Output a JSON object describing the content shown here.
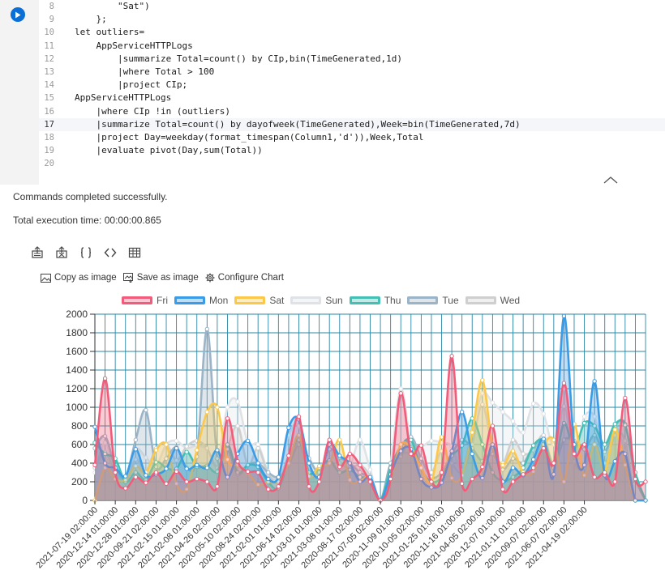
{
  "editor": {
    "lines": [
      {
        "num": "8",
        "text": "        \"Sat\")"
      },
      {
        "num": "9",
        "text": "    };"
      },
      {
        "num": "10",
        "text": "let outliers="
      },
      {
        "num": "11",
        "text": "    AppServiceHTTPLogs"
      },
      {
        "num": "12",
        "text": "        |summarize Total=count() by CIp,bin(TimeGenerated,1d)"
      },
      {
        "num": "13",
        "text": "        |where Total > 100"
      },
      {
        "num": "14",
        "text": "        |project CIp;"
      },
      {
        "num": "15",
        "text": "AppServiceHTTPLogs"
      },
      {
        "num": "16",
        "text": "    |where CIp !in (outliers)"
      },
      {
        "num": "17",
        "text": "    |summarize Total=count() by dayofweek(TimeGenerated),Week=bin(TimeGenerated,7d)"
      },
      {
        "num": "18",
        "text": "    |project Day=weekday(format_timespan(Column1,'d')),Week,Total"
      },
      {
        "num": "19",
        "text": "    |evaluate pivot(Day,sum(Total))"
      },
      {
        "num": "20",
        "text": ""
      }
    ]
  },
  "status": {
    "message": "Commands completed successfully.",
    "execution_time": "Total execution time: 00:00:00.865"
  },
  "chart_actions": {
    "copy": "Copy as image",
    "save": "Save as image",
    "configure": "Configure Chart"
  },
  "legend": [
    {
      "name": "Fri",
      "color": "#f25c7a"
    },
    {
      "name": "Mon",
      "color": "#3a9be6"
    },
    {
      "name": "Sat",
      "color": "#fcc84a"
    },
    {
      "name": "Sun",
      "color": "#dfe2e6"
    },
    {
      "name": "Thu",
      "color": "#45bfb4"
    },
    {
      "name": "Tue",
      "color": "#9bb4c7"
    },
    {
      "name": "Wed",
      "color": "#cfcfcf"
    }
  ],
  "chart_data": {
    "type": "area",
    "ylim": [
      0,
      2000
    ],
    "yticks": [
      0,
      200,
      400,
      600,
      800,
      1000,
      1200,
      1400,
      1600,
      1800,
      2000
    ],
    "grid": true,
    "legend_position": "top",
    "xticks": [
      "2021-07-19 02:00:00",
      "2020-12-14 01:00:00",
      "2020-12-28 01:00:00",
      "2020-09-21 02:00:00",
      "2021-02-15 01:00:00",
      "2021-02-08 01:00:00",
      "2021-04-26 02:00:00",
      "2020-05-10 02:00:00",
      "2020-08-24 02:00:00",
      "2021-02-01 01:00:00",
      "2021-06-14 02:00:00",
      "2021-03-01 01:00:00",
      "2021-03-08 01:00:00",
      "2020-08-17 02:00:00",
      "2021-07-05 02:00:00",
      "2020-11-09 01:00:00",
      "2020-10-05 02:00:00",
      "2021-01-25 01:00:00",
      "2020-11-16 01:00:00",
      "2021-04-05 02:00:00",
      "2020-12-07 01:00:00",
      "2021-01-11 01:00:00",
      "2020-09-07 02:00:00",
      "2021-06-07 02:00:00",
      "2021-04-19 02:00:00"
    ],
    "points_per_interval": 2,
    "series": [
      {
        "name": "Fri",
        "values": [
          380,
          1310,
          300,
          130,
          250,
          190,
          300,
          180,
          310,
          200,
          230,
          200,
          150,
          880,
          420,
          310,
          300,
          120,
          150,
          480,
          900,
          150,
          200,
          650,
          360,
          500,
          380,
          200,
          0,
          230,
          1150,
          500,
          590,
          200,
          300,
          1550,
          180,
          230,
          360,
          800,
          120,
          200,
          280,
          350,
          560,
          400,
          1260,
          500,
          600,
          250,
          300,
          200,
          1100,
          230,
          200
        ]
      },
      {
        "name": "Mon",
        "values": [
          790,
          400,
          350,
          260,
          550,
          270,
          280,
          340,
          560,
          340,
          380,
          350,
          540,
          250,
          500,
          640,
          400,
          230,
          250,
          780,
          870,
          400,
          250,
          600,
          480,
          400,
          200,
          250,
          0,
          280,
          530,
          550,
          230,
          140,
          190,
          530,
          950,
          500,
          240,
          600,
          200,
          350,
          270,
          440,
          660,
          280,
          1980,
          600,
          380,
          1280,
          270,
          420,
          500,
          0,
          0
        ]
      },
      {
        "name": "Sat",
        "values": [
          0,
          350,
          230,
          220,
          370,
          300,
          540,
          600,
          180,
          120,
          540,
          950,
          1000,
          440,
          380,
          300,
          170,
          200,
          200,
          400,
          700,
          260,
          370,
          400,
          650,
          220,
          210,
          250,
          0,
          220,
          600,
          560,
          350,
          200,
          680,
          240,
          270,
          730,
          1290,
          580,
          380,
          530,
          300,
          310,
          600,
          650,
          200,
          820,
          270,
          600,
          310,
          760,
          380,
          0,
          0
        ]
      },
      {
        "name": "Sun",
        "values": [
          300,
          620,
          300,
          250,
          550,
          460,
          370,
          600,
          640,
          560,
          590,
          550,
          400,
          1000,
          1060,
          620,
          600,
          310,
          250,
          700,
          800,
          350,
          300,
          400,
          300,
          360,
          650,
          330,
          0,
          400,
          1200,
          620,
          580,
          640,
          620,
          580,
          320,
          750,
          1150,
          1050,
          950,
          850,
          730,
          1040,
          930,
          600,
          1200,
          500,
          900,
          900,
          500,
          800,
          500,
          0,
          0
        ]
      },
      {
        "name": "Thu",
        "values": [
          620,
          500,
          450,
          200,
          300,
          220,
          410,
          350,
          340,
          520,
          360,
          370,
          310,
          600,
          300,
          380,
          360,
          200,
          130,
          420,
          650,
          300,
          350,
          430,
          300,
          330,
          250,
          230,
          0,
          350,
          580,
          650,
          340,
          200,
          250,
          480,
          590,
          880,
          600,
          300,
          210,
          250,
          350,
          590,
          640,
          350,
          830,
          550,
          830,
          800,
          600,
          820,
          810,
          300,
          0
        ]
      },
      {
        "name": "Tue",
        "values": [
          560,
          690,
          360,
          250,
          650,
          970,
          360,
          450,
          570,
          350,
          470,
          1840,
          450,
          550,
          280,
          380,
          400,
          300,
          250,
          380,
          600,
          450,
          300,
          550,
          460,
          400,
          300,
          230,
          0,
          400,
          470,
          680,
          450,
          250,
          300,
          500,
          650,
          560,
          420,
          500,
          330,
          450,
          400,
          580,
          650,
          380,
          650,
          640,
          550,
          700,
          520,
          800,
          820,
          250,
          0
        ]
      },
      {
        "name": "Wed",
        "values": [
          350,
          520,
          300,
          200,
          440,
          310,
          560,
          610,
          430,
          580,
          640,
          560,
          350,
          570,
          800,
          380,
          560,
          280,
          200,
          480,
          600,
          320,
          300,
          550,
          400,
          350,
          380,
          260,
          0,
          350,
          500,
          500,
          450,
          300,
          530,
          400,
          300,
          600,
          1030,
          560,
          400,
          650,
          500,
          540,
          700,
          400,
          1010,
          420,
          350,
          600,
          400,
          700,
          640,
          0,
          0
        ]
      }
    ]
  }
}
